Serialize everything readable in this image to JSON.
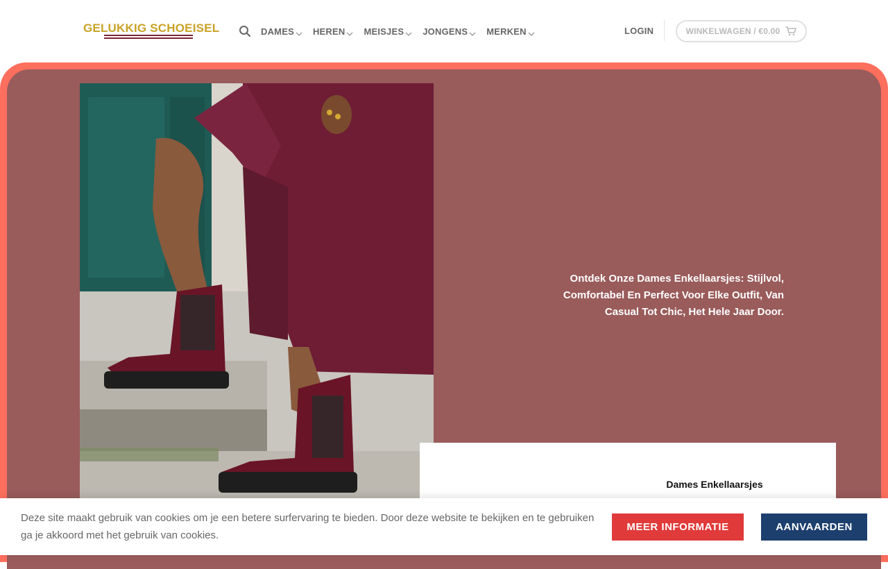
{
  "brand": {
    "logo_text": "GELUKKIG SCHOEISEL",
    "logo_color": "#c9a227",
    "accent_color": "#7a2334"
  },
  "header": {
    "search_icon": "search-icon",
    "nav": [
      {
        "label": "DAMES",
        "icon": "chevron-down-icon"
      },
      {
        "label": "HEREN",
        "icon": "chevron-down-icon"
      },
      {
        "label": "MEISJES",
        "icon": "chevron-down-icon"
      },
      {
        "label": "JONGENS",
        "icon": "chevron-down-icon"
      },
      {
        "label": "MERKEN",
        "icon": "chevron-down-icon"
      }
    ],
    "login_label": "LOGIN",
    "cart_label": "WINKELWAGEN / €0.00",
    "cart_icon": "shopping-cart-icon"
  },
  "hero": {
    "outer_color": "#ff6f5e",
    "inner_color": "#9a5b5b",
    "text": "Ontdek Onze Dames Enkellaarsjes: Stijlvol, Comfortabel En Perfect Voor Elke Outfit, Van Casual Tot Chic, Het Hele Jaar Door.",
    "card_title": "Dames Enkellaarsjes"
  },
  "cookie": {
    "text": "Deze site maakt gebruik van cookies om je een betere surfervaring te bieden. Door deze website te bekijken en te gebruiken ga je akkoord met het gebruik van cookies.",
    "info_button": "MEER INFORMATIE",
    "accept_button": "AANVAARDEN",
    "info_color": "#e03a3a",
    "accept_color": "#1c3f6e"
  }
}
